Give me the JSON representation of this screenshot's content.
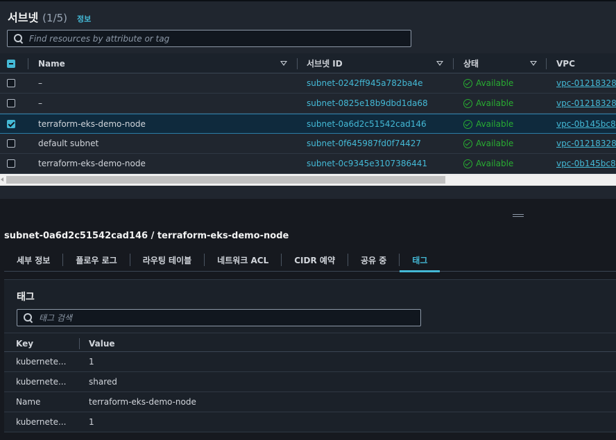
{
  "subnets": {
    "title": "서브넷",
    "count": "(1/5)",
    "info_link": "정보",
    "search_placeholder": "Find resources by attribute or tag",
    "columns": [
      "Name",
      "서브넷 ID",
      "상태",
      "VPC"
    ],
    "rows": [
      {
        "name": "–",
        "subnet_id": "subnet-0242ff945a782ba4e",
        "status": "Available",
        "vpc": "vpc-01218328",
        "selected": false
      },
      {
        "name": "–",
        "subnet_id": "subnet-0825e18b9dbd1da68",
        "status": "Available",
        "vpc": "vpc-01218328",
        "selected": false
      },
      {
        "name": "terraform-eks-demo-node",
        "subnet_id": "subnet-0a6d2c51542cad146",
        "status": "Available",
        "vpc": "vpc-0b145bc8",
        "selected": true
      },
      {
        "name": "default subnet",
        "subnet_id": "subnet-0f645987fd0f74427",
        "status": "Available",
        "vpc": "vpc-01218328",
        "selected": false
      },
      {
        "name": "terraform-eks-demo-node",
        "subnet_id": "subnet-0c9345e3107386441",
        "status": "Available",
        "vpc": "vpc-0b145bc8",
        "selected": false
      }
    ]
  },
  "detail": {
    "title": "subnet-0a6d2c51542cad146 / terraform-eks-demo-node",
    "tabs": [
      "세부 정보",
      "플로우 로그",
      "라우팅 테이블",
      "네트워크 ACL",
      "CIDR 예약",
      "공유 중",
      "태그"
    ],
    "active_tab": "태그"
  },
  "tags": {
    "heading": "태그",
    "search_placeholder": "태그 검색",
    "columns": [
      "Key",
      "Value"
    ],
    "rows": [
      {
        "key": "kubernete...",
        "value": "1"
      },
      {
        "key": "kubernete...",
        "value": "shared"
      },
      {
        "key": "Name",
        "value": "terraform-eks-demo-node"
      },
      {
        "key": "kubernete...",
        "value": "1"
      }
    ]
  },
  "colors": {
    "link": "#44b9d6",
    "available": "#29ad32",
    "selected_row": "#0f2a3d"
  }
}
